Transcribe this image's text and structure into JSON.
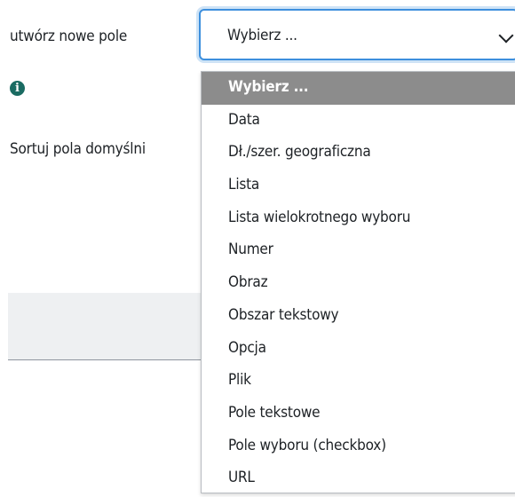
{
  "form": {
    "new_field_label": "utwórz nowe pole",
    "info_icon": "info-circle-icon",
    "sort_label": "Sortuj pola domyślni"
  },
  "select": {
    "value": "Wybierz ...",
    "icon": "chevron-down-icon"
  },
  "dropdown": {
    "options": [
      "Wybierz ...",
      "Data",
      "Dł./szer. geograficzna",
      "Lista",
      "Lista wielokrotnego wyboru",
      "Numer",
      "Obraz",
      "Obszar tekstowy",
      "Opcja",
      "Plik",
      "Pole tekstowe",
      "Pole wyboru (checkbox)",
      "URL"
    ],
    "selected_index": 0
  },
  "colors": {
    "focus_border": "#3d8fdd",
    "info_icon": "#1a6b62",
    "selected_option_bg": "#8c8c8c"
  }
}
